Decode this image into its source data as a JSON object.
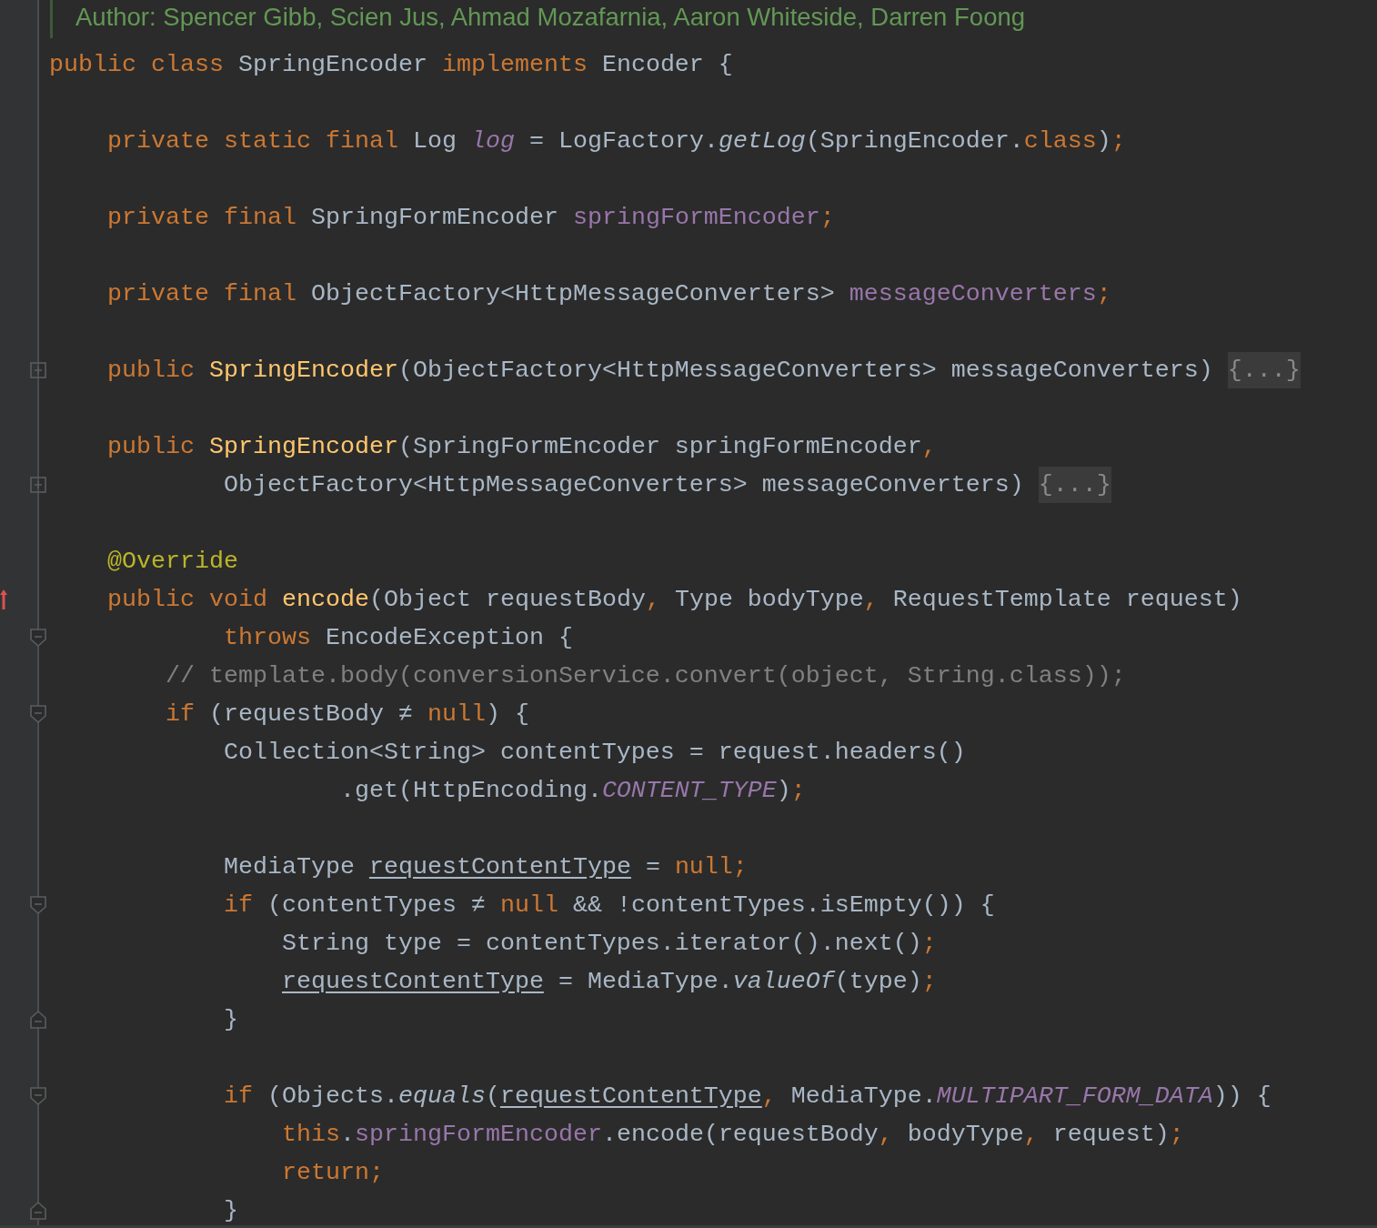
{
  "editor": {
    "lines": [
      {
        "kind": "doc",
        "text": "Author: Spencer Gibb, Scien Jus, Ahmad Mozafarnia, Aaron Whiteside, Darren Foong"
      },
      {
        "kind": "code",
        "tokens": [
          {
            "kind": "keyword",
            "text": "public class"
          },
          {
            "kind": "plain",
            "text": " SpringEncoder"
          },
          {
            "kind": "keyword",
            "text": " implements"
          },
          {
            "kind": "plain",
            "text": " Encoder {"
          }
        ]
      },
      {
        "kind": "blank"
      },
      {
        "kind": "code",
        "tokens": [
          {
            "kind": "keyword",
            "text": "    private static final"
          },
          {
            "kind": "plain",
            "text": " Log"
          },
          {
            "kind": "static-field",
            "text": " log"
          },
          {
            "kind": "plain",
            "text": " = LogFactory."
          },
          {
            "kind": "static-call",
            "text": "getLog"
          },
          {
            "kind": "plain",
            "text": "(SpringEncoder."
          },
          {
            "kind": "keyword",
            "text": "class"
          },
          {
            "kind": "plain",
            "text": ")"
          },
          {
            "kind": "keyword",
            "text": ";"
          }
        ]
      },
      {
        "kind": "blank"
      },
      {
        "kind": "code",
        "tokens": [
          {
            "kind": "keyword",
            "text": "    private final"
          },
          {
            "kind": "plain",
            "text": " SpringFormEncoder"
          },
          {
            "kind": "field",
            "text": " springFormEncoder"
          },
          {
            "kind": "keyword",
            "text": ";"
          }
        ]
      },
      {
        "kind": "blank"
      },
      {
        "kind": "code",
        "tokens": [
          {
            "kind": "keyword",
            "text": "    private final"
          },
          {
            "kind": "plain",
            "text": " ObjectFactory<HttpMessageConverters>"
          },
          {
            "kind": "field",
            "text": " messageConverters"
          },
          {
            "kind": "keyword",
            "text": ";"
          }
        ]
      },
      {
        "kind": "blank"
      },
      {
        "kind": "code",
        "gutter_icon": {
          "kind": "fold-plus"
        },
        "tokens": [
          {
            "kind": "keyword",
            "text": "    public"
          },
          {
            "kind": "method-decl",
            "text": " SpringEncoder"
          },
          {
            "kind": "plain",
            "text": "(ObjectFactory<HttpMessageConverters> messageConverters)"
          },
          {
            "kind": "fold",
            "text": " {...}"
          }
        ]
      },
      {
        "kind": "blank"
      },
      {
        "kind": "code",
        "tokens": [
          {
            "kind": "keyword",
            "text": "    public"
          },
          {
            "kind": "method-decl",
            "text": " SpringEncoder"
          },
          {
            "kind": "plain",
            "text": "(SpringFormEncoder springFormEncoder"
          },
          {
            "kind": "keyword",
            "text": ","
          }
        ]
      },
      {
        "kind": "code",
        "gutter_icon": {
          "kind": "fold-plus"
        },
        "tokens": [
          {
            "kind": "plain",
            "text": "            ObjectFactory<HttpMessageConverters> messageConverters)"
          },
          {
            "kind": "fold",
            "text": " {...}"
          }
        ]
      },
      {
        "kind": "blank"
      },
      {
        "kind": "code",
        "tokens": [
          {
            "kind": "annotation",
            "text": "    @Override"
          }
        ]
      },
      {
        "kind": "code",
        "gutter_icon": {
          "kind": "override"
        },
        "tokens": [
          {
            "kind": "keyword",
            "text": "    public void"
          },
          {
            "kind": "method-decl",
            "text": " encode"
          },
          {
            "kind": "plain",
            "text": "(Object requestBody"
          },
          {
            "kind": "keyword",
            "text": ","
          },
          {
            "kind": "plain",
            "text": " Type bodyType"
          },
          {
            "kind": "keyword",
            "text": ","
          },
          {
            "kind": "plain",
            "text": " RequestTemplate request)"
          }
        ]
      },
      {
        "kind": "code",
        "gutter_icon": {
          "kind": "fold-start"
        },
        "tokens": [
          {
            "kind": "keyword",
            "text": "            throws"
          },
          {
            "kind": "plain",
            "text": " EncodeException {"
          }
        ]
      },
      {
        "kind": "code",
        "tokens": [
          {
            "kind": "comment",
            "text": "        // template.body(conversionService.convert(object, String.class));"
          }
        ]
      },
      {
        "kind": "code",
        "gutter_icon": {
          "kind": "fold-start"
        },
        "tokens": [
          {
            "kind": "keyword",
            "text": "        if"
          },
          {
            "kind": "plain",
            "text": " (requestBody ≠"
          },
          {
            "kind": "keyword",
            "text": " null"
          },
          {
            "kind": "plain",
            "text": ") {"
          }
        ]
      },
      {
        "kind": "code",
        "tokens": [
          {
            "kind": "plain",
            "text": "            Collection<String> contentTypes = request.headers()"
          }
        ]
      },
      {
        "kind": "code",
        "tokens": [
          {
            "kind": "plain",
            "text": "                    .get(HttpEncoding."
          },
          {
            "kind": "static-field",
            "text": "CONTENT_TYPE"
          },
          {
            "kind": "plain",
            "text": ")"
          },
          {
            "kind": "keyword",
            "text": ";"
          }
        ]
      },
      {
        "kind": "blank"
      },
      {
        "kind": "code",
        "tokens": [
          {
            "kind": "plain",
            "text": "            MediaType"
          },
          {
            "kind": "reassigned",
            "text": " requestContentType"
          },
          {
            "kind": "plain",
            "text": " ="
          },
          {
            "kind": "keyword",
            "text": " null;"
          }
        ]
      },
      {
        "kind": "code",
        "gutter_icon": {
          "kind": "fold-start"
        },
        "tokens": [
          {
            "kind": "keyword",
            "text": "            if"
          },
          {
            "kind": "plain",
            "text": " (contentTypes ≠"
          },
          {
            "kind": "keyword",
            "text": " null"
          },
          {
            "kind": "plain",
            "text": " && !contentTypes.isEmpty()) {"
          }
        ]
      },
      {
        "kind": "code",
        "tokens": [
          {
            "kind": "plain",
            "text": "                String type = contentTypes.iterator().next()"
          },
          {
            "kind": "keyword",
            "text": ";"
          }
        ]
      },
      {
        "kind": "code",
        "tokens": [
          {
            "kind": "reassigned",
            "text": "                requestContentType"
          },
          {
            "kind": "plain",
            "text": " = MediaType."
          },
          {
            "kind": "static-call",
            "text": "valueOf"
          },
          {
            "kind": "plain",
            "text": "(type)"
          },
          {
            "kind": "keyword",
            "text": ";"
          }
        ]
      },
      {
        "kind": "code",
        "gutter_icon": {
          "kind": "fold-end"
        },
        "tokens": [
          {
            "kind": "plain",
            "text": "            }"
          }
        ]
      },
      {
        "kind": "blank"
      },
      {
        "kind": "code",
        "gutter_icon": {
          "kind": "fold-start"
        },
        "tokens": [
          {
            "kind": "keyword",
            "text": "            if"
          },
          {
            "kind": "plain",
            "text": " (Objects."
          },
          {
            "kind": "static-call",
            "text": "equals"
          },
          {
            "kind": "plain",
            "text": "("
          },
          {
            "kind": "reassigned",
            "text": "requestContentType"
          },
          {
            "kind": "keyword",
            "text": ","
          },
          {
            "kind": "plain",
            "text": " MediaType."
          },
          {
            "kind": "static-field",
            "text": "MULTIPART_FORM_DATA"
          },
          {
            "kind": "plain",
            "text": ")) {"
          }
        ]
      },
      {
        "kind": "code",
        "tokens": [
          {
            "kind": "keyword",
            "text": "                this"
          },
          {
            "kind": "plain",
            "text": "."
          },
          {
            "kind": "field",
            "text": "springFormEncoder"
          },
          {
            "kind": "plain",
            "text": ".encode(requestBody"
          },
          {
            "kind": "keyword",
            "text": ","
          },
          {
            "kind": "plain",
            "text": " bodyType"
          },
          {
            "kind": "keyword",
            "text": ","
          },
          {
            "kind": "plain",
            "text": " request)"
          },
          {
            "kind": "keyword",
            "text": ";"
          }
        ]
      },
      {
        "kind": "code",
        "tokens": [
          {
            "kind": "keyword",
            "text": "                return;"
          }
        ]
      },
      {
        "kind": "code",
        "gutter_icon": {
          "kind": "fold-end"
        },
        "tokens": [
          {
            "kind": "plain",
            "text": "            }"
          }
        ]
      }
    ]
  }
}
